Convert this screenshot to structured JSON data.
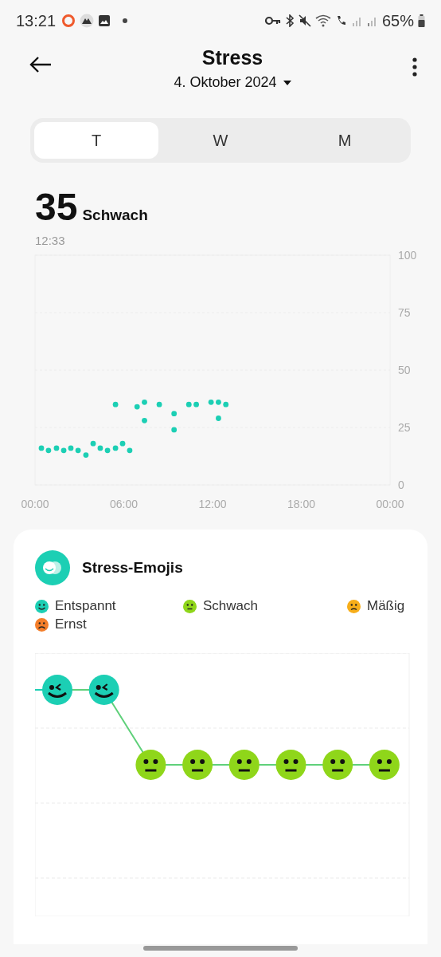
{
  "status_bar": {
    "time": "13:21",
    "battery": "65%"
  },
  "header": {
    "title": "Stress",
    "date": "4. Oktober 2024"
  },
  "tabs": [
    {
      "label": "T",
      "selected": true
    },
    {
      "label": "W",
      "selected": false
    },
    {
      "label": "M",
      "selected": false
    }
  ],
  "reading": {
    "value": "35",
    "label": "Schwach",
    "time": "12:33"
  },
  "chart_data": {
    "type": "scatter",
    "x": [
      0.43,
      0.91,
      1.45,
      1.94,
      2.42,
      2.91,
      3.44,
      3.93,
      4.41,
      4.9,
      5.44,
      5.92,
      6.4,
      5.44,
      6.9,
      7.4,
      7.4,
      8.4,
      9.4,
      9.4,
      10.4,
      10.9,
      11.9,
      12.4,
      12.4,
      12.9
    ],
    "series": [
      {
        "color": "#1ccfb4",
        "values": [
          16,
          15,
          16,
          15,
          16,
          15,
          13,
          18,
          16,
          15,
          16,
          18,
          15,
          35,
          34,
          36,
          28,
          35,
          31,
          24,
          35,
          35,
          36,
          36,
          29,
          35
        ]
      }
    ],
    "xlim": [
      0,
      24
    ],
    "ylim": [
      0,
      100
    ],
    "xticks": [
      {
        "value": 0,
        "label": "00:00"
      },
      {
        "value": 6,
        "label": "06:00"
      },
      {
        "value": 12,
        "label": "12:00"
      },
      {
        "value": 18,
        "label": "18:00"
      },
      {
        "value": 24,
        "label": "00:00"
      }
    ],
    "yticks": [
      0,
      25,
      50,
      75,
      100
    ],
    "grid": true
  },
  "emoji_card": {
    "title": "Stress-Emojis",
    "legend": [
      {
        "label": "Entspannt",
        "kind": "relaxed",
        "color": "#1ccfb4"
      },
      {
        "label": "Schwach",
        "kind": "weak",
        "color": "#8fd61a"
      },
      {
        "label": "Mäßig",
        "kind": "moderate",
        "color": "#f7ae1a"
      },
      {
        "label": "Ernst",
        "kind": "severe",
        "color": "#f47e2a"
      }
    ],
    "timeline": [
      {
        "kind": "relaxed"
      },
      {
        "kind": "relaxed"
      },
      {
        "kind": "weak"
      },
      {
        "kind": "weak"
      },
      {
        "kind": "weak"
      },
      {
        "kind": "weak"
      },
      {
        "kind": "weak"
      },
      {
        "kind": "weak"
      }
    ]
  }
}
